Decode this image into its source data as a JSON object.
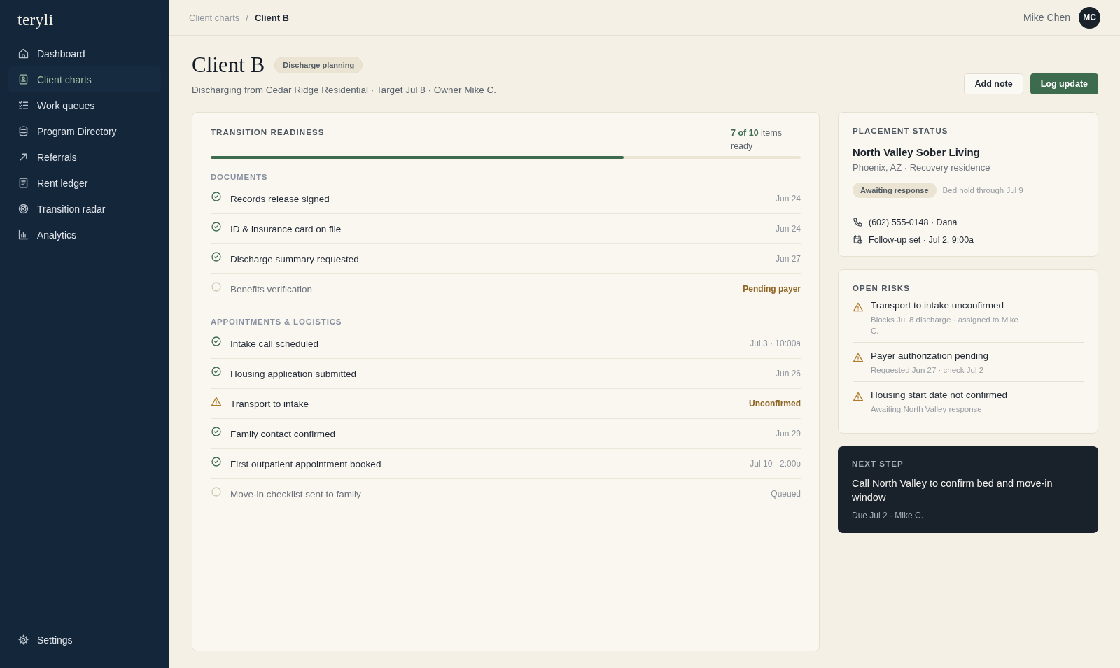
{
  "brand": "teryli",
  "nav": [
    {
      "label": "Dashboard",
      "selected": false
    },
    {
      "label": "Client charts",
      "selected": true
    },
    {
      "label": "Work queues",
      "selected": false
    },
    {
      "label": "Program Directory",
      "selected": false
    },
    {
      "label": "Referrals",
      "selected": false
    },
    {
      "label": "Rent ledger",
      "selected": false
    },
    {
      "label": "Transition radar",
      "selected": false
    },
    {
      "label": "Analytics",
      "selected": false
    }
  ],
  "settings": "Settings",
  "breadcrumb": [
    "Client charts",
    "Client B"
  ],
  "breadcrumb_separator": "/",
  "user": {
    "name": "Mike Chen",
    "initials": "MC"
  },
  "client": {
    "name": "Client B",
    "tag": "Discharge planning",
    "subtitle": "Discharging from Cedar Ridge Residential · Target Jul 8 · Owner Mike C."
  },
  "actions": [
    {
      "label": "Add note",
      "kind": "secondary"
    },
    {
      "label": "Log update",
      "kind": "primary"
    }
  ],
  "readiness": {
    "title": "TRANSITION READINESS",
    "count": "7 of 10",
    "count_suffix": "items ready",
    "level": 0.7,
    "sections": [
      {
        "title": "DOCUMENTS",
        "items": [
          {
            "label": "Records release signed",
            "meta": "Jun 24",
            "kind": "done",
            "alert": false
          },
          {
            "label": "ID & insurance card on file",
            "meta": "Jun 24",
            "kind": "done",
            "alert": false
          },
          {
            "label": "Discharge summary requested",
            "meta": "Jun 27",
            "kind": "done",
            "alert": false
          },
          {
            "label": "Benefits verification",
            "meta": "Pending payer",
            "kind": "pending",
            "alert": true
          }
        ]
      },
      {
        "title": "APPOINTMENTS & LOGISTICS",
        "items": [
          {
            "label": "Intake call scheduled",
            "meta": "Jul 3 · 10:00a",
            "kind": "done",
            "alert": false
          },
          {
            "label": "Housing application submitted",
            "meta": "Jun 26",
            "kind": "done",
            "alert": false
          },
          {
            "label": "Transport to intake",
            "meta": "Unconfirmed",
            "kind": "warning",
            "alert": true
          },
          {
            "label": "Family contact confirmed",
            "meta": "Jun 29",
            "kind": "done",
            "alert": false
          },
          {
            "label": "First outpatient appointment booked",
            "meta": "Jul 10 · 2:00p",
            "kind": "done",
            "alert": false
          },
          {
            "label": "Move-in checklist sent to family",
            "meta": "Queued",
            "kind": "pending",
            "alert": false
          }
        ]
      }
    ]
  },
  "placement": {
    "title": "PLACEMENT STATUS",
    "name": "North Valley Sober Living",
    "location": "Phoenix, AZ · Recovery residence",
    "status": "Awaiting response",
    "note": "Bed hold through Jul 9",
    "phone": "(602) 555-0148 · Dana",
    "followup": "Follow-up set · Jul 2, 9:00a"
  },
  "risks": {
    "title": "OPEN RISKS",
    "items": [
      {
        "title": "Transport to intake unconfirmed",
        "detail": "Blocks Jul 8 discharge · assigned to Mike C."
      },
      {
        "title": "Payer authorization pending",
        "detail": "Requested Jun 27 · check Jul 2"
      },
      {
        "title": "Housing start date not confirmed",
        "detail": "Awaiting North Valley response"
      }
    ]
  },
  "next_step": {
    "title": "NEXT STEP",
    "text": "Call North Valley to confirm bed and move-in window",
    "meta": "Due Jul 2 · Mike C."
  }
}
